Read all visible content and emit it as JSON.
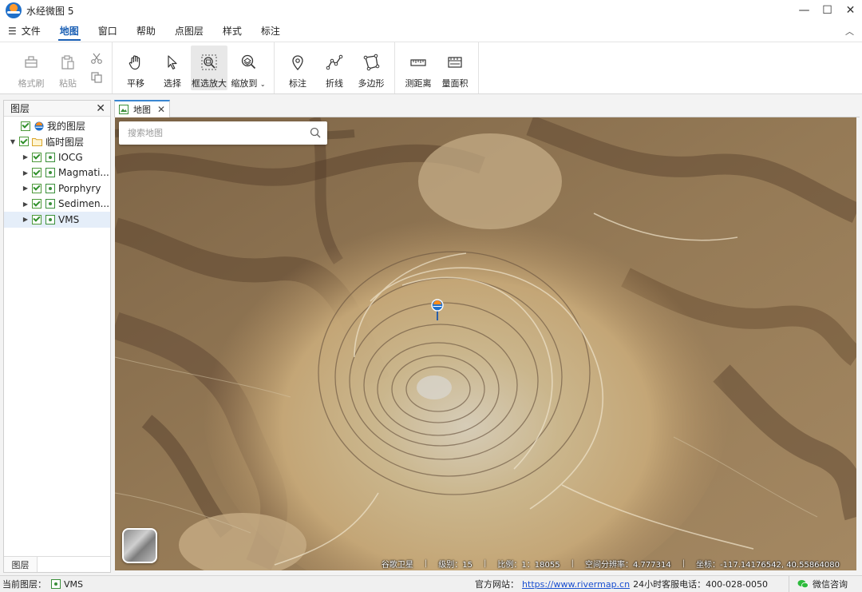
{
  "window": {
    "title": "水经微图 5",
    "controls": [
      "—",
      "☐",
      "✕"
    ]
  },
  "menu": {
    "hamburger": "☰",
    "file": "文件",
    "items": [
      "地图",
      "窗口",
      "帮助",
      "点图层",
      "样式",
      "标注"
    ],
    "active": "地图",
    "collapse": "︿"
  },
  "ribbon": {
    "format_brush": "格式刷",
    "paste": "粘贴",
    "pan": "平移",
    "select": "选择",
    "box_zoom": "框选放大",
    "zoom_to": "缩放到",
    "marker": "标注",
    "polyline": "折线",
    "polygon": "多边形",
    "measure_distance": "测距离",
    "measure_area": "量面积"
  },
  "layer_panel": {
    "title": "图层",
    "close": "✕",
    "my_layers": "我的图层",
    "temp_layers": "临时图层",
    "layers": [
      "IOCG",
      "Magmati...",
      "Porphyry",
      "Sedimen...",
      "VMS"
    ],
    "selected_layer": "VMS",
    "footer_tab": "图层"
  },
  "doc_tab": {
    "label": "地图",
    "close": "✕"
  },
  "search": {
    "placeholder": "搜索地图"
  },
  "map_status": {
    "source": "谷歌卫星",
    "level_label": "级别：",
    "level": "15",
    "scale_label": "比例：",
    "scale": "1：18055",
    "resolution_label": "空间分辨率：",
    "resolution": "4.777314",
    "coord_label": "坐标：",
    "coords": "-117.14176542, 40.55864080"
  },
  "statusbar": {
    "current_layer_label": "当前图层：",
    "current_layer": "VMS",
    "website_label": "官方网站：",
    "website_url": "https://www.rivermap.cn",
    "hotline": "24小时客服电话：400-028-0050",
    "wechat": "微信咨询"
  },
  "colors": {
    "accent": "#1a5fb4",
    "tab_highlight": "#3a86d1",
    "checkbox_green": "#2f8f2a",
    "link": "#1a4fd0"
  }
}
